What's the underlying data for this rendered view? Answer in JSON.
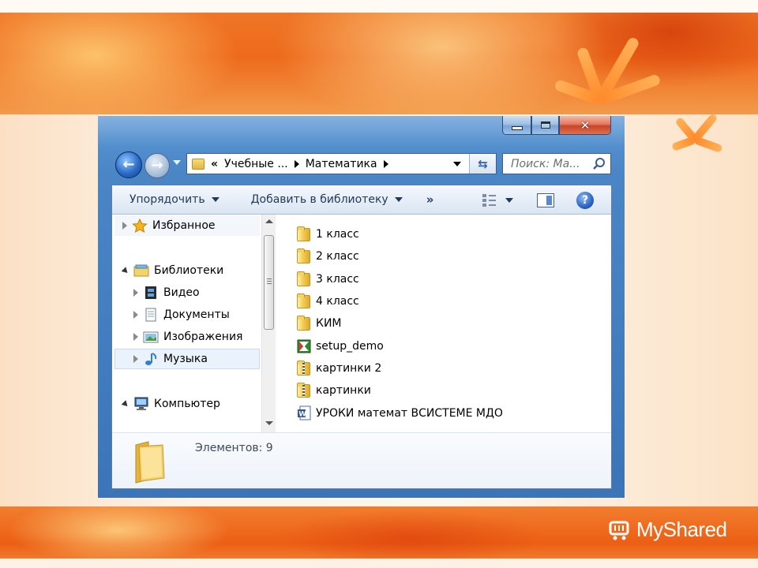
{
  "window": {
    "address": {
      "overflow": "«",
      "segments": [
        "Учебные ...",
        "Математика"
      ]
    },
    "search_placeholder": "Поиск: Ма...",
    "toolbar": {
      "organize": "Упорядочить",
      "add_to_library": "Добавить в библиотеку",
      "more": "»",
      "help": "?"
    },
    "nav_pane": {
      "favorites": "Избранное",
      "libraries": "Библиотеки",
      "library_items": [
        "Видео",
        "Документы",
        "Изображения",
        "Музыка"
      ],
      "computer": "Компьютер",
      "selected": "Музыка"
    },
    "files": [
      {
        "name": "1 класс",
        "icon": "folder-icon"
      },
      {
        "name": "2 класс",
        "icon": "folder-icon"
      },
      {
        "name": "3 класс",
        "icon": "folder-icon"
      },
      {
        "name": "4 класс",
        "icon": "folder-icon"
      },
      {
        "name": "КИМ",
        "icon": "folder-icon"
      },
      {
        "name": "setup_demo",
        "icon": "setup-app-icon"
      },
      {
        "name": "картинки 2",
        "icon": "zip-folder-icon"
      },
      {
        "name": "картинки",
        "icon": "zip-folder-icon"
      },
      {
        "name": "УРОКИ  математ ВСИСТЕМЕ МДО",
        "icon": "word-document-icon"
      }
    ],
    "details": {
      "item_count": "Элементов: 9"
    }
  },
  "branding": {
    "logo_text": "MyShared"
  },
  "colors": {
    "window_frame": "#4a86c6",
    "slide_accent": "#ee6a1c",
    "close_button": "#c9432a"
  }
}
